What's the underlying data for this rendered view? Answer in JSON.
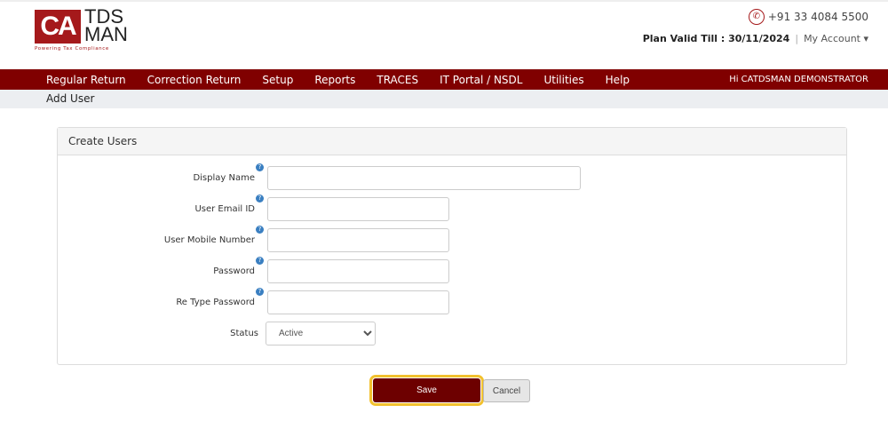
{
  "brand": {
    "logo_mark": "CA",
    "logo_text_1": "TDS",
    "logo_text_2": "MAN",
    "tagline": "Powering Tax Compliance"
  },
  "header": {
    "phone": "+91 33 4084 5500",
    "plan_label": "Plan Valid Till : 30/11/2024",
    "separator": "|",
    "account": "My Account ▾"
  },
  "nav": {
    "items": [
      "Regular Return",
      "Correction Return",
      "Setup",
      "Reports",
      "TRACES",
      "IT Portal / NSDL",
      "Utilities",
      "Help"
    ],
    "greeting": "Hi CATDSMAN DEMONSTRATOR"
  },
  "breadcrumb": "Add User",
  "panel": {
    "title": "Create Users",
    "help": "?",
    "fields": [
      {
        "label": "Display Name",
        "value": ""
      },
      {
        "label": "User Email ID",
        "value": ""
      },
      {
        "label": "User Mobile Number",
        "value": ""
      },
      {
        "label": "Password",
        "value": ""
      },
      {
        "label": "Re Type Password",
        "value": ""
      }
    ],
    "status_label": "Status",
    "status_value": "Active"
  },
  "buttons": {
    "save": "Save",
    "cancel": "Cancel"
  }
}
